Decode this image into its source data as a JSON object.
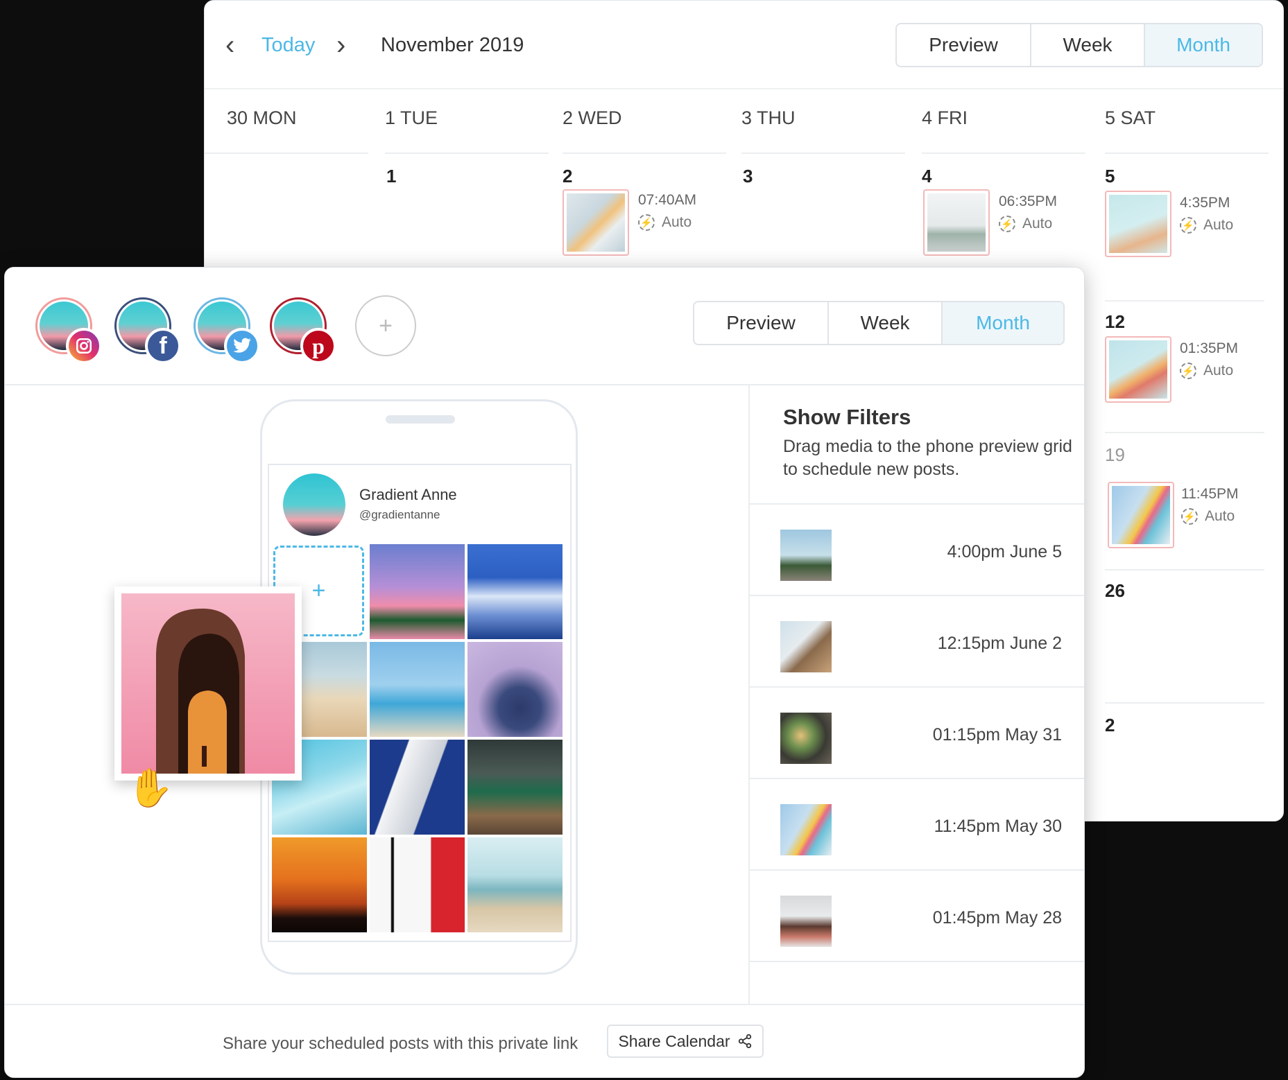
{
  "calendar": {
    "today_label": "Today",
    "month_title": "November 2019",
    "view_buttons": [
      "Preview",
      "Week",
      "Month"
    ],
    "active_view": "Month",
    "days": [
      "30 MON",
      "1 TUE",
      "2 WED",
      "3 THU",
      "4 FRI",
      "5 SAT"
    ],
    "dates": [
      "1",
      "2",
      "3",
      "4",
      "5",
      "12",
      "19",
      "26",
      "2"
    ],
    "posts": [
      {
        "time": "07:40AM",
        "mode": "Auto"
      },
      {
        "time": "06:35PM",
        "mode": "Auto"
      },
      {
        "time": "4:35PM",
        "mode": "Auto"
      },
      {
        "time": "01:35PM",
        "mode": "Auto"
      },
      {
        "time": "11:45PM",
        "mode": "Auto"
      }
    ]
  },
  "front": {
    "accounts": [
      {
        "network": "instagram",
        "ring_color": "#f29a9a",
        "badge_color": "#c13584"
      },
      {
        "network": "facebook",
        "ring_color": "#3b4f7a",
        "badge_color": "#3b5998"
      },
      {
        "network": "twitter",
        "ring_color": "#6ab6e4",
        "badge_color": "#4aa3e6"
      },
      {
        "network": "pinterest",
        "ring_color": "#b0202f",
        "badge_color": "#bd081c"
      }
    ],
    "add_account_label": "+",
    "view_buttons": [
      "Preview",
      "Week",
      "Month"
    ],
    "active_view": "Month",
    "profile": {
      "name": "Gradient Anne",
      "handle": "@gradientanne"
    },
    "drop_label": "+",
    "filters": {
      "title": "Show Filters",
      "description": "Drag media to the phone preview grid to schedule new posts.",
      "scheduled": [
        "4:00pm June 5",
        "12:15pm June 2",
        "01:15pm May 31",
        "11:45pm May 30",
        "01:45pm May 28"
      ]
    },
    "footer": {
      "text": "Share your scheduled posts with this private link",
      "share_label": "Share Calendar"
    }
  },
  "colors": {
    "accent": "#4cb8e6",
    "dark_bg": "#0d0d0d"
  }
}
